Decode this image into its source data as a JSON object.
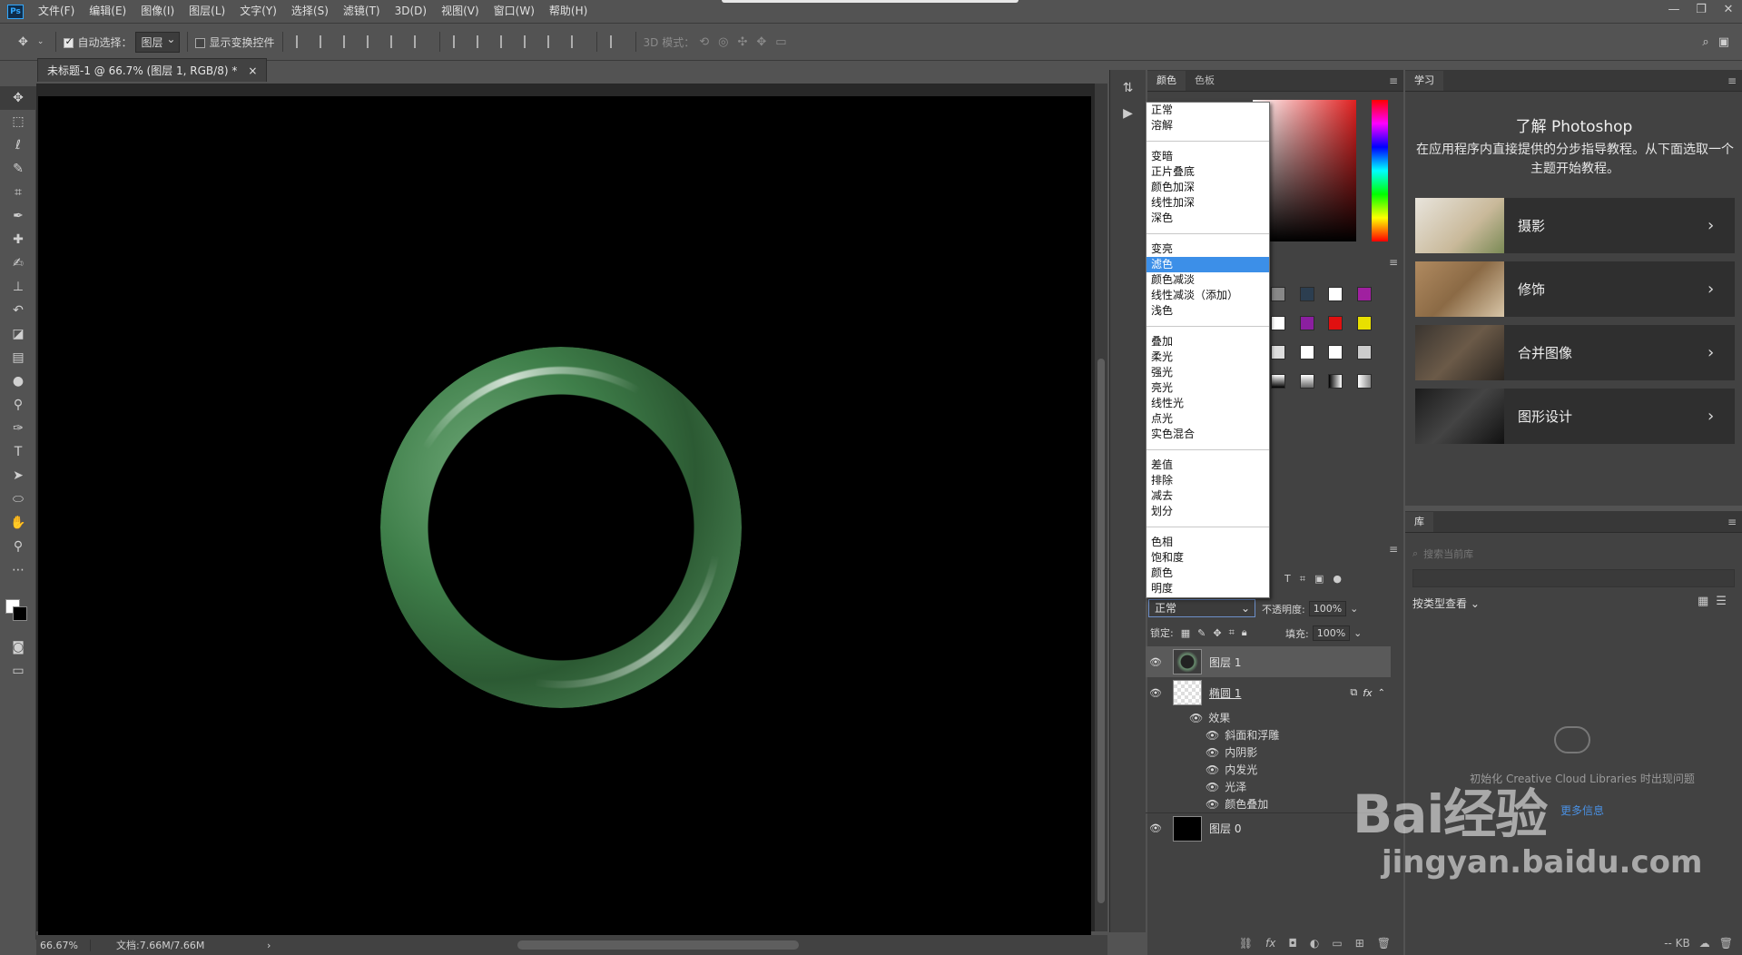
{
  "app": {
    "logo": "Ps"
  },
  "menu": [
    "文件(F)",
    "编辑(E)",
    "图像(I)",
    "图层(L)",
    "文字(Y)",
    "选择(S)",
    "滤镜(T)",
    "3D(D)",
    "视图(V)",
    "窗口(W)",
    "帮助(H)"
  ],
  "window_controls": [
    "—",
    "❐",
    "✕"
  ],
  "options": {
    "auto_select_label": "自动选择：",
    "auto_select_value": "图层",
    "show_transform_label": "显示变换控件",
    "mode_3d_label": "3D 模式："
  },
  "document": {
    "tab_title": "未标题-1 @ 66.7% (图层 1, RGB/8) *",
    "close": "×"
  },
  "status": {
    "zoom": "66.67%",
    "doc_size": "文档:7.66M/7.66M",
    "arrow": "›"
  },
  "color_panel": {
    "tabs": [
      "颜色",
      "色板"
    ]
  },
  "blend_modes": [
    [
      "正常",
      "溶解"
    ],
    [
      "变暗",
      "正片叠底",
      "颜色加深",
      "线性加深",
      "深色"
    ],
    [
      "变亮",
      "滤色",
      "颜色减淡",
      "线性减淡（添加）",
      "浅色"
    ],
    [
      "叠加",
      "柔光",
      "强光",
      "亮光",
      "线性光",
      "点光",
      "实色混合"
    ],
    [
      "差值",
      "排除",
      "减去",
      "划分"
    ],
    [
      "色相",
      "饱和度",
      "颜色",
      "明度"
    ]
  ],
  "blend_selected": "滤色",
  "layers_panel": {
    "blend_value": "正常",
    "opacity_label": "不透明度:",
    "opacity_value": "100%",
    "lock_label": "锁定:",
    "fill_label": "填充:",
    "fill_value": "100%",
    "layers": [
      {
        "name": "图层 1"
      },
      {
        "name": "椭圆 1"
      },
      {
        "name": "图层 0"
      }
    ],
    "effects_label": "效果",
    "effects": [
      "斜面和浮雕",
      "内阴影",
      "内发光",
      "光泽",
      "颜色叠加"
    ]
  },
  "learn_panel": {
    "tab": "学习",
    "title": "了解 Photoshop",
    "description": "在应用程序内直接提供的分步指导教程。从下面选取一个主题开始教程。",
    "cards": [
      "摄影",
      "修饰",
      "合并图像",
      "图形设计"
    ]
  },
  "library_panel": {
    "tab": "库",
    "search_placeholder": "搜索当前库",
    "view_by": "按类型查看",
    "empty_text": "初始化 Creative Cloud Libraries 时出现问题",
    "link": "更多信息",
    "size": "-- KB"
  },
  "watermark": {
    "main": "Bai经验",
    "sub": "jingyan.baidu.com"
  },
  "colors": {
    "workspace": "#535353",
    "panel": "#424242",
    "canvas": "#000000",
    "selection": "#3c8fe8",
    "jade": "#3f7f4a"
  }
}
